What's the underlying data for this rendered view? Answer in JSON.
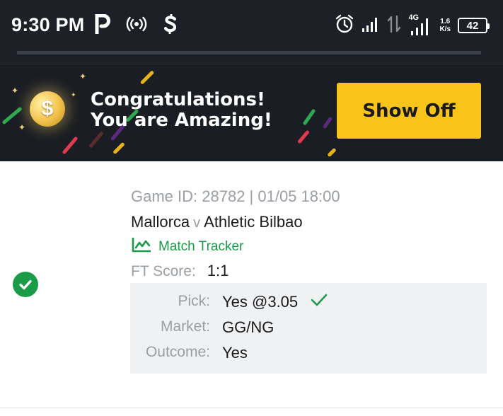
{
  "status_bar": {
    "time": "9:30 PM",
    "left_icons": [
      "parking-p-icon",
      "hotspot-broadcast-icon",
      "dollar-app-icon"
    ],
    "right_icons": [
      "alarm-icon",
      "signal-bars-icon",
      "data-arrows-icon",
      "signal-4g-icon"
    ],
    "network_type": "4G",
    "net_speed_value": "1.6",
    "net_speed_unit": "K/s",
    "battery": "42"
  },
  "banner": {
    "line1": "Congratulations!",
    "line2": "You are Amazing!",
    "button_label": "Show Off",
    "coin_symbol": "$",
    "colors": {
      "background": "#1a1d23",
      "button": "#f9c41a",
      "stripe_green": "#2fa84f",
      "stripe_red": "#e03a4e",
      "stripe_yellow": "#e8b21a",
      "stripe_purple": "#5b2a80"
    }
  },
  "bet": {
    "status_icon": "check-circle-icon",
    "game_id": "Game ID: 28782 | 01/05 18:00",
    "home_team": "Mallorca",
    "vs": "v",
    "away_team": "Athletic Bilbao",
    "tracker_label": "Match Tracker",
    "ft_label": "FT Score:",
    "ft_value": "1:1",
    "details": [
      {
        "label": "Pick:",
        "value": "Yes @3.05",
        "won": true
      },
      {
        "label": "Market:",
        "value": "GG/NG"
      },
      {
        "label": "Outcome:",
        "value": "Yes"
      }
    ],
    "colors": {
      "win_green": "#1a9b47",
      "muted_text": "#9a9ea5",
      "details_bg": "#f0f1f3"
    }
  }
}
